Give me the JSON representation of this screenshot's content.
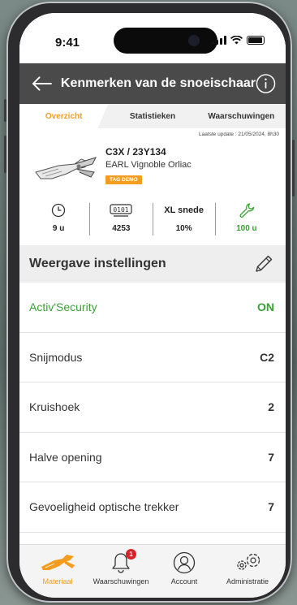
{
  "status_bar": {
    "time": "9:41"
  },
  "app_bar": {
    "title": "Kenmerken van de snoeischaar"
  },
  "tabs": [
    {
      "label": "Overzicht",
      "active": true
    },
    {
      "label": "Statistieken",
      "active": false
    },
    {
      "label": "Waarschuwingen",
      "active": false
    }
  ],
  "last_update": "Laatste update : 21/05/2024, 8h30",
  "device": {
    "model": "C3X / 23Y134",
    "owner": "EARL Vignoble Orliac",
    "tag": "TAG DEMO"
  },
  "stats": [
    {
      "icon": "clock-icon",
      "value": "9 u"
    },
    {
      "icon": "counter-icon",
      "value": "4253"
    },
    {
      "icon": "",
      "heading": "XL snede",
      "value": "10%"
    },
    {
      "icon": "wrench-icon",
      "value": "100 u"
    }
  ],
  "settings": {
    "title": "Weergave instellingen",
    "rows": [
      {
        "name": "Activ'Security",
        "value": "ON",
        "highlight": true
      },
      {
        "name": "Snijmodus",
        "value": "C2"
      },
      {
        "name": "Kruishoek",
        "value": "2"
      },
      {
        "name": "Halve opening",
        "value": "7"
      },
      {
        "name": "Gevoeligheid optische trekker",
        "value": "7"
      }
    ]
  },
  "bottom_nav": [
    {
      "label": "Materiaal",
      "icon": "shears-icon",
      "active": true
    },
    {
      "label": "Waarschuwingen",
      "icon": "bell-icon",
      "badge": "1"
    },
    {
      "label": "Account",
      "icon": "account-icon"
    },
    {
      "label": "Administratie",
      "icon": "gears-icon"
    }
  ],
  "colors": {
    "accent": "#f39c1e",
    "green": "#3aa135",
    "appbar": "#4a4a4a",
    "badge": "#d8222a"
  }
}
